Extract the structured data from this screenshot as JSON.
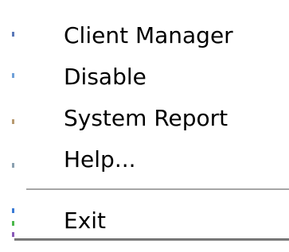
{
  "menu": {
    "items": [
      {
        "label": "Client Manager"
      },
      {
        "label": "Disable"
      },
      {
        "label": "System Report"
      },
      {
        "label": "Help..."
      }
    ],
    "exit_label": "Exit"
  }
}
